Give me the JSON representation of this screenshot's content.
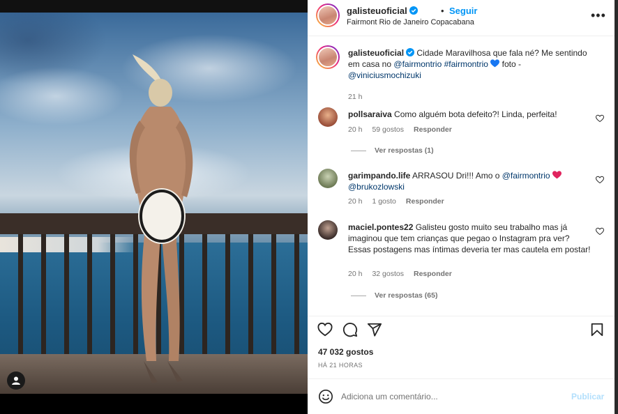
{
  "post": {
    "username": "galisteuoficial",
    "follow_label": "Seguir",
    "dot": "•",
    "location": "Fairmont Rio de Janeiro Copacabana",
    "more_label": "•••"
  },
  "caption": {
    "username": "galisteuoficial",
    "text": "Cidade Maravilhosa que fala né? Me sentindo em casa no",
    "mention1": "@fairmontrio",
    "hashtag": "#fairmontrio",
    "text2": "foto -",
    "mention2": "@viniciusmochizuki",
    "time": "21 h"
  },
  "comments": [
    {
      "username": "pollsaraiva",
      "text": "Como alguém bota defeito?! Linda, perfeita!",
      "time": "20 h",
      "likes": "59 gostos",
      "reply": "Responder",
      "view_replies": "Ver respostas (1)"
    },
    {
      "username": "garimpando.life",
      "text": "ARRASOU Dri!!! Amo o",
      "mention1": "@fairmontrio",
      "mention2": "@brukozlowski",
      "time": "20 h",
      "likes": "1 gosto",
      "reply": "Responder"
    },
    {
      "username": "maciel.pontes22",
      "text": "Galisteu gosto muito seu trabalho mas já imaginou que tem crianças que pegao o Instagram pra ver? Essas postagens mas íntimas deveria ter mas cautela em postar!",
      "time": "20 h",
      "likes": "32 gostos",
      "reply": "Responder",
      "view_replies": "Ver respostas (65)"
    }
  ],
  "stats": {
    "likes": "47 032 gostos",
    "time_ago": "HÁ 21 HORAS"
  },
  "composer": {
    "placeholder": "Adiciona um comentário...",
    "publish_label": "Publicar"
  },
  "colors": {
    "accent": "#0095f6",
    "link": "#00376b",
    "heart_red": "#e0245e",
    "blue_heart": "#1877f2",
    "publish_disabled": "#b2dffc"
  },
  "icons": [
    "verified-badge-icon",
    "more-options-icon",
    "heart-icon",
    "comment-icon",
    "share-icon",
    "bookmark-icon",
    "emoji-icon",
    "user-tag-icon"
  ]
}
